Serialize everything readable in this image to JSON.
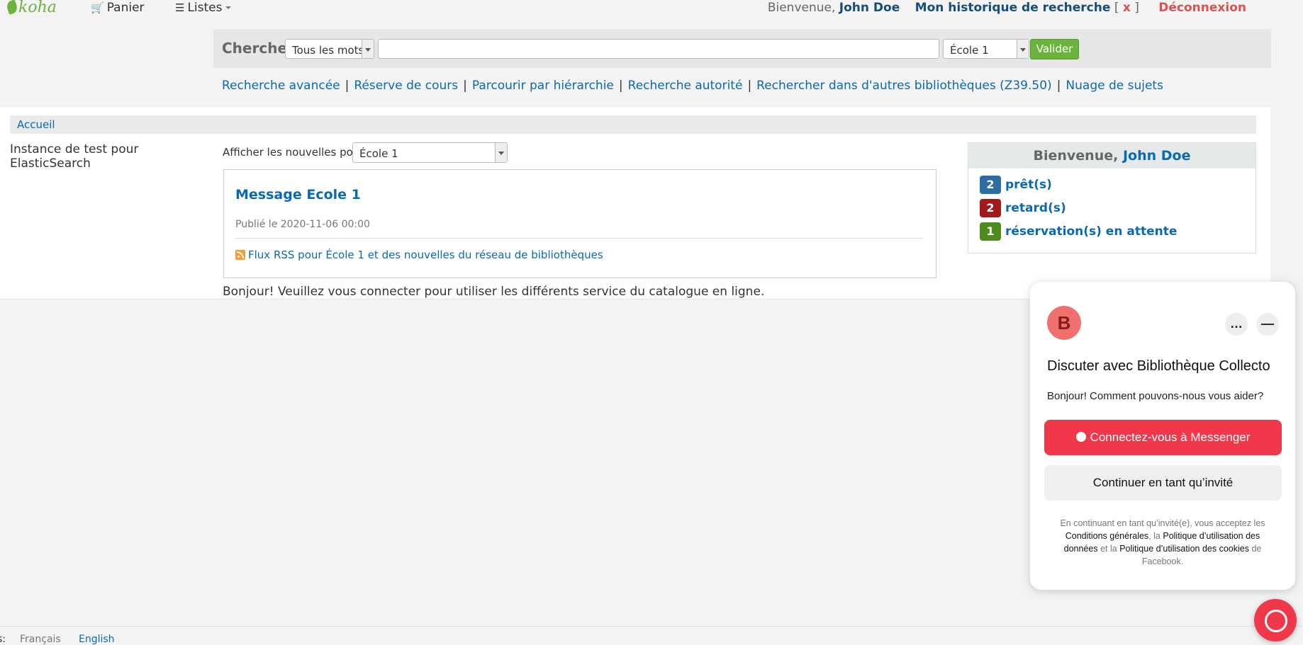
{
  "topbar": {
    "logo": "koha",
    "cart_label": "Panier",
    "lists_label": "Listes",
    "welcome_prefix": "Bienvenue,",
    "user_name": "John Doe",
    "history_label": "Mon historique de recherche",
    "history_open": "[",
    "history_clear": "x",
    "history_close": "]",
    "logout_label": "Déconnexion"
  },
  "search": {
    "label": "Chercher",
    "type_selected": "Tous les mots",
    "query_value": "",
    "library_selected": "École 1",
    "submit_label": "Valider"
  },
  "more_searches": [
    "Recherche avancée",
    "Réserve de cours",
    "Parcourir par hiérarchie",
    "Recherche autorité",
    "Rechercher dans d'autres bibliothèques (Z39.50)",
    "Nuage de sujets"
  ],
  "separator": "|",
  "breadcrumb": {
    "home": "Accueil"
  },
  "left_column": {
    "text": "Instance de test pour ElasticSearch"
  },
  "news": {
    "filter_label": "Afficher les nouvelles pour:",
    "filter_selected": "École 1",
    "title": "Message Ecole 1",
    "published": "Publié le 2020-11-06 00:00",
    "rss_label": "Flux RSS pour École 1 et des nouvelles du réseau de bibliothèques"
  },
  "greeting": "Bonjour! Veuillez vous connecter pour utiliser les différents service du catalogue en ligne.",
  "user_summary": {
    "welcome_prefix": "Bienvenue,",
    "user_name": "John Doe",
    "items": [
      {
        "count": "2",
        "label": "prêt(s)",
        "color": "#2e6da4"
      },
      {
        "count": "2",
        "label": "retard(s)",
        "color": "#a21a1a"
      },
      {
        "count": "1",
        "label": "réservation(s) en attente",
        "color": "#4e8b1c"
      }
    ]
  },
  "footer": {
    "lang_label": "s:",
    "languages": [
      "Français",
      "English"
    ]
  },
  "chat": {
    "avatar_letter": "B",
    "more_icon": "…",
    "minimize_icon": "—",
    "title": "Discuter avec Bibliothèque Collecto",
    "subtitle": "Bonjour! Comment pouvons-nous vous aider?",
    "connect_label": "Connectez-vous à Messenger",
    "guest_label": "Continuer en tant qu’invité",
    "legal": {
      "p1": "En continuant en tant qu’invité(e), vous acceptez les",
      "terms": "Conditions générales",
      "p2": ", la",
      "data_policy": "Politique d’utilisation des données",
      "p3": "et la",
      "cookies_policy": "Politique d’utilisation des cookies",
      "p4": "de Facebook."
    },
    "brand_color": "#f0384a"
  }
}
